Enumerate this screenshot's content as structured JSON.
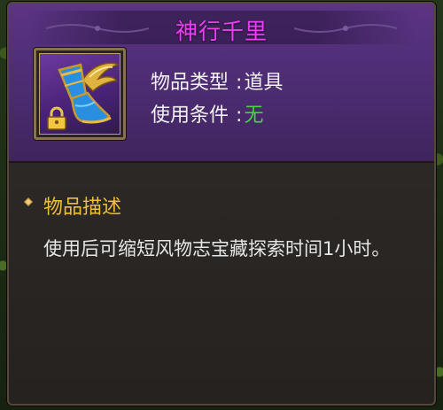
{
  "item": {
    "name": "神行千里",
    "type_label": "物品类型",
    "type_value": "道具",
    "condition_label": "使用条件",
    "condition_value": "无",
    "separator": ":"
  },
  "description": {
    "heading": "物品描述",
    "text": "使用后可缩短风物志宝藏探索时间1小时。"
  },
  "icons": {
    "item_icon": "winged-boot-icon",
    "bound_icon": "lock-icon",
    "bullet_icon": "diamond-bullet-icon"
  },
  "colors": {
    "title": "#ec3ff0",
    "condition_value": "#46d443",
    "section_heading": "#efbf3a",
    "header_bg": "#4b2b70",
    "body_bg": "#2b2725"
  }
}
